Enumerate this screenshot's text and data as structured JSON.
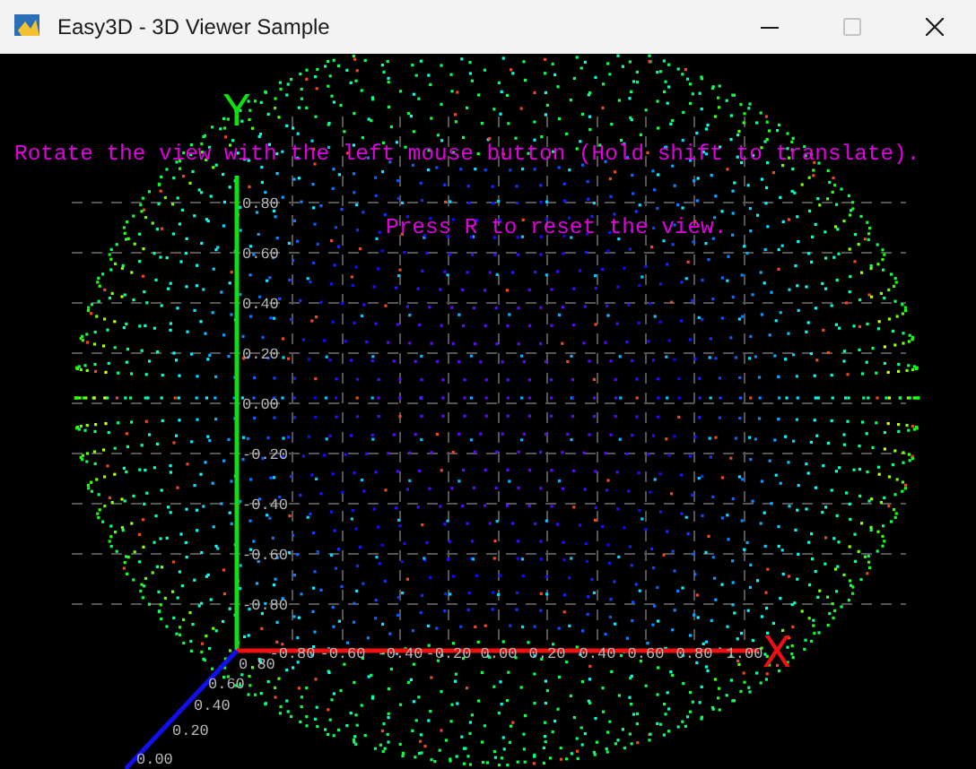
{
  "window": {
    "title": "Easy3D - 3D Viewer Sample",
    "controls": [
      {
        "kind": "minimize",
        "disabled": false
      },
      {
        "kind": "maximize",
        "disabled": true
      },
      {
        "kind": "close",
        "disabled": false
      }
    ]
  },
  "messages": [
    "Rotate the view with the left mouse button (Hold shift to translate).",
    "Press R to reset the view."
  ],
  "axes": {
    "y": {
      "label": "Y",
      "ticks": [
        "0.80",
        "0.60",
        "0.40",
        "0.20",
        "0.00",
        "-0.20",
        "-0.40",
        "-0.60",
        "-0.80"
      ]
    },
    "x": {
      "label": "X",
      "ticks": [
        "-0.80",
        "-0.60",
        "-0.40",
        "-0.20",
        "0.00",
        "0.20",
        "0.40",
        "0.60",
        "0.80",
        "1.00"
      ]
    },
    "z": {
      "ticks": [
        "0.80",
        "0.60",
        "0.40",
        "0.20",
        "0.00"
      ]
    }
  }
}
